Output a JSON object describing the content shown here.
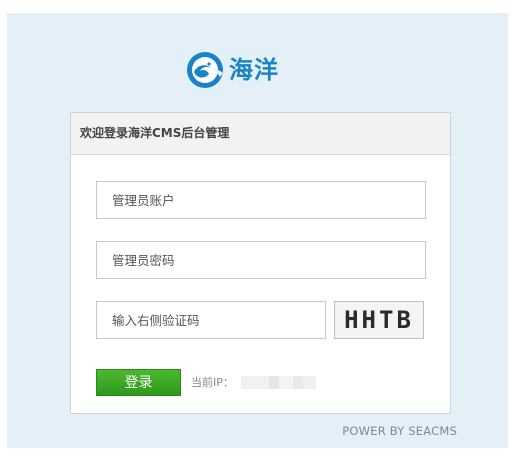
{
  "logo": {
    "text": "海洋",
    "icon": "wave-c-logo-icon",
    "color": "#1a83c6"
  },
  "panel": {
    "title": "欢迎登录海洋CMS后台管理"
  },
  "form": {
    "username": {
      "placeholder": "管理员账户",
      "value": ""
    },
    "password": {
      "placeholder": "管理员密码",
      "value": ""
    },
    "captcha": {
      "placeholder": "输入右侧验证码",
      "value": ""
    },
    "captcha_image_text": "HHTB",
    "login_button": "登录",
    "ip_label": "当前IP：",
    "ip_value": ""
  },
  "footer": {
    "power": "POWER BY SEACMS"
  },
  "colors": {
    "background": "#e3f0f8",
    "button_green": "#3aa826"
  }
}
